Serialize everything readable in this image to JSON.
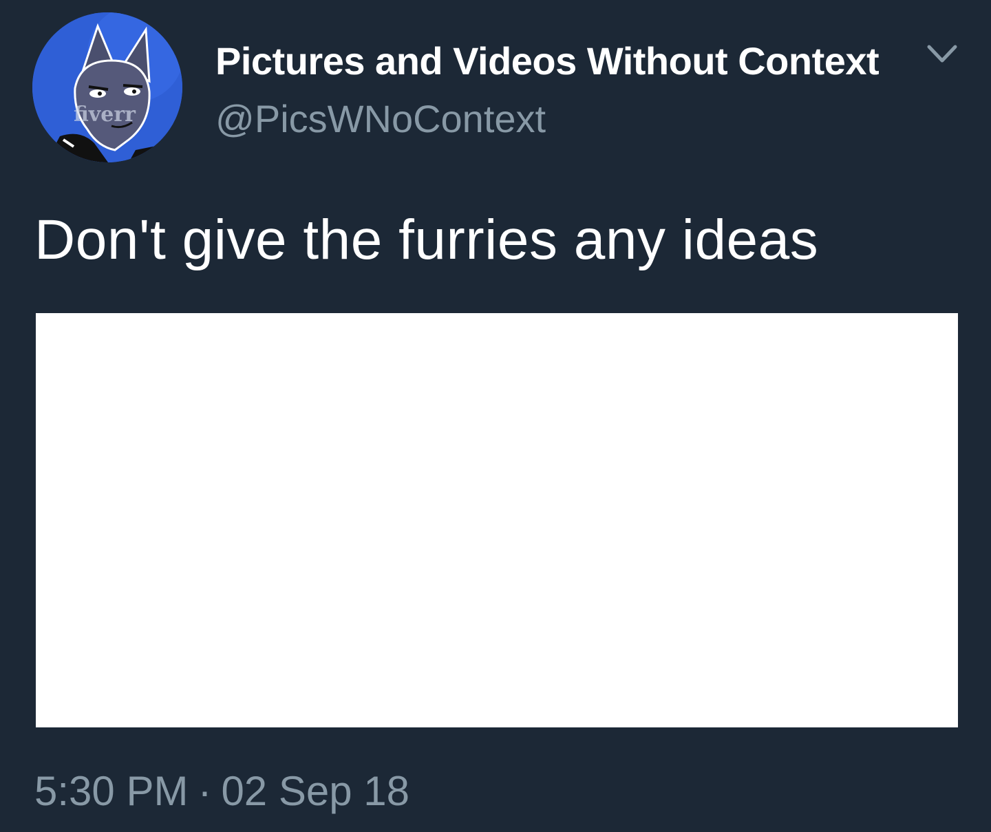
{
  "tweet": {
    "author": {
      "display_name": "Pictures and Videos Without Context",
      "handle": "@PicsWNoContext",
      "avatar_watermark": "fiverr"
    },
    "menu_icon": "chevron-down-icon",
    "text": "Don't give the furries any ideas",
    "time": "5:30 PM",
    "separator": "·",
    "date": "02 Sep 18"
  },
  "colors": {
    "background": "#1c2836",
    "primary_text": "#ffffff",
    "secondary_text": "#8899a6",
    "avatar_background": "#2f5fd6",
    "media_background": "#ffffff"
  }
}
